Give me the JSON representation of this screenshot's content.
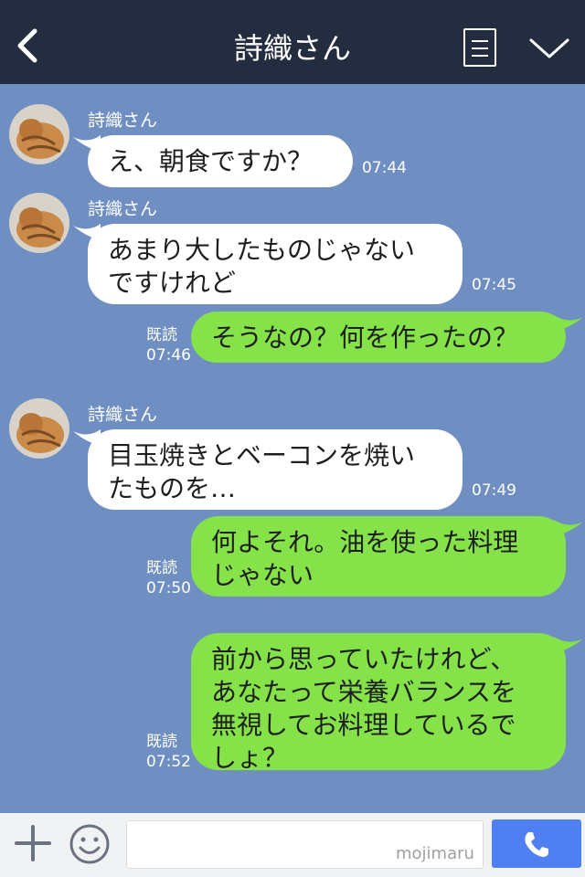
{
  "header": {
    "title": "詩織さん",
    "icons": [
      "back-icon",
      "menu-icon",
      "chevron-down-icon"
    ]
  },
  "messages": [
    {
      "side": "in",
      "sender": "詩織さん",
      "text": "え、朝食ですか？",
      "time": "07:44"
    },
    {
      "side": "in",
      "sender": "詩織さん",
      "text": "あまり大したものじゃない\nですけれど",
      "time": "07:45"
    },
    {
      "side": "out",
      "text": "そうなの？何を作ったの？",
      "read": "既読",
      "time": "07:46"
    },
    {
      "side": "in",
      "sender": "詩織さん",
      "text": "目玉焼きとベーコンを焼い\nたものを…",
      "time": "07:49"
    },
    {
      "side": "out",
      "text": "何よそれ。油を使った料理\nじゃない",
      "read": "既読",
      "time": "07:50"
    },
    {
      "side": "out",
      "text": "前から思っていたけれど、\nあなたって栄養バランスを\n無視してお料理しているで\nしょ？",
      "read": "既読",
      "time": "07:52"
    }
  ],
  "input": {
    "watermark": "mojimaru",
    "icons": [
      "plus-icon",
      "smile-icon",
      "phone-icon"
    ]
  },
  "colors": {
    "header_bg": "#242c40",
    "chat_bg": "#6f8fc3",
    "incoming_bubble": "#ffffff",
    "outgoing_bubble": "#85e249",
    "call_button": "#4f7ff0"
  }
}
